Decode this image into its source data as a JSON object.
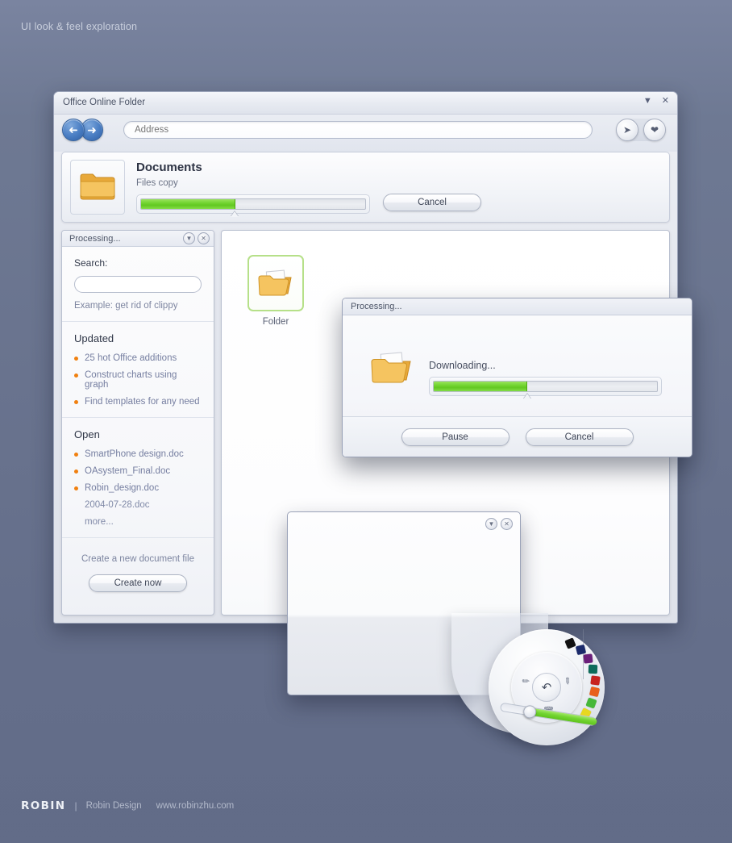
{
  "page": {
    "title": "UI look & feel exploration",
    "background_color": "#6b7693",
    "accent_green": "#73d532",
    "accent_orange": "#f08010",
    "link_color": "#757ea0"
  },
  "window": {
    "title": "Office Online Folder",
    "titlebar_icons": [
      "chevron-down-icon",
      "close-icon"
    ],
    "toolbar": {
      "back_icon": "arrow-left-icon",
      "forward_icon": "arrow-right-icon",
      "address_placeholder": "Address",
      "address_value": "",
      "go_icon": "go-arrow-icon",
      "favorite_icon": "heart-icon"
    },
    "doc_panel": {
      "icon": "folder-icon",
      "title": "Documents",
      "subtitle": "Files copy",
      "progress_percent": 42,
      "cancel_label": "Cancel"
    },
    "sidebar": {
      "header_title": "Processing...",
      "header_icons": [
        "chevron-down-icon",
        "close-icon"
      ],
      "search_label": "Search:",
      "search_value": "",
      "search_placeholder": "",
      "search_example": "Example: get rid of clippy",
      "updated_title": "Updated",
      "updated_items": [
        "25 hot Office additions",
        "Construct charts using graph",
        "Find templates for any need"
      ],
      "open_title": "Open",
      "open_items": [
        {
          "label": "SmartPhone design.doc",
          "bulleted": true
        },
        {
          "label": "OAsystem_Final.doc",
          "bulleted": true
        },
        {
          "label": "Robin_design.doc",
          "bulleted": true
        },
        {
          "label": "2004-07-28.doc",
          "bulleted": false
        },
        {
          "label": "more...",
          "bulleted": false
        }
      ],
      "create_text": "Create a new document file",
      "create_button": "Create now"
    },
    "content": {
      "files": [
        {
          "name": "Folder",
          "icon": "folder-open-icon",
          "selected": true
        }
      ]
    }
  },
  "dialog": {
    "title": "Processing...",
    "icon": "folder-open-icon",
    "status": "Downloading...",
    "progress_percent": 42,
    "pause_label": "Pause",
    "cancel_label": "Cancel"
  },
  "panel2": {
    "icons": [
      "chevron-down-icon",
      "close-icon"
    ]
  },
  "wheel": {
    "center_icon": "download-arrow-icon",
    "pen_icon": "pencil-icon",
    "eraser_icon": "eraser-icon",
    "trash_icon": "trash-icon",
    "slider_percent": 70,
    "palette_colors": [
      "#111111",
      "#1b2a6b",
      "#6b1f7a",
      "#0e6b5a",
      "#c8231f",
      "#e8601c",
      "#46b83a",
      "#e8d820"
    ]
  },
  "footer": {
    "logo": "ROBIN",
    "separator": "|",
    "brand": "Robin Design",
    "url": "www.robinzhu.com"
  }
}
